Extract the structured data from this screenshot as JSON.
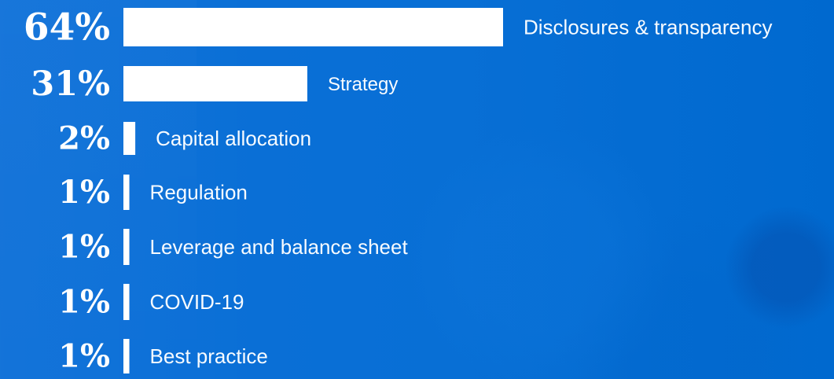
{
  "chart_data": {
    "type": "bar",
    "orientation": "horizontal",
    "categories": [
      "Disclosures & transparency",
      "Strategy",
      "Capital allocation",
      "Regulation",
      "Leverage and balance sheet",
      "COVID-19",
      "Best practice"
    ],
    "values": [
      64,
      31,
      2,
      1,
      1,
      1,
      1
    ],
    "value_labels": [
      "64%",
      "31%",
      "2%",
      "1%",
      "1%",
      "1%",
      "1%"
    ],
    "grid": false,
    "legend": "none"
  },
  "colors": {
    "background": "#0a72d6",
    "bar": "#ffffff",
    "text": "#ffffff"
  }
}
